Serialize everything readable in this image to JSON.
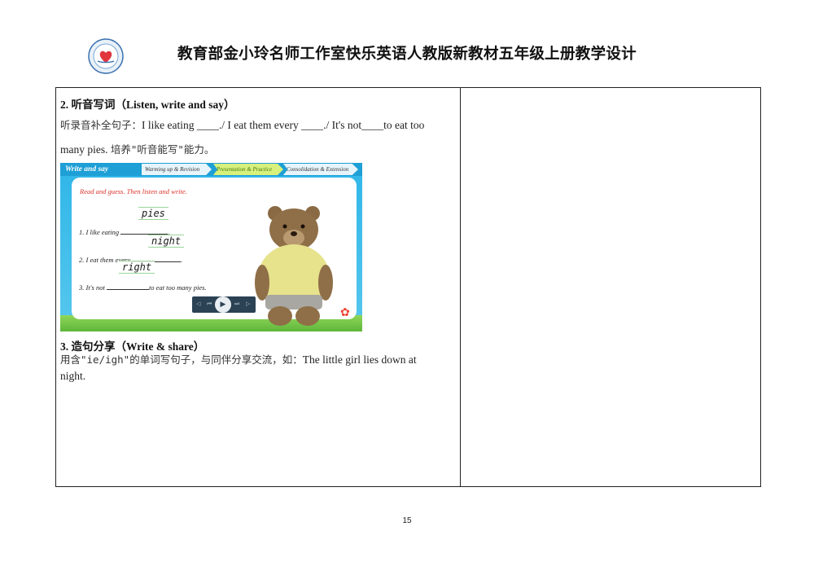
{
  "header": {
    "title": "教育部金小玲名师工作室快乐英语人教版新教材五年级上册教学设计"
  },
  "section2": {
    "heading": "2. 听音写词（Listen, write and say）",
    "line1_cn": "听录音补全句子：",
    "line1_en": "I like eating ____./ I eat them every ____./ It's not____to eat too",
    "line2_en": "many pies.",
    "line2_cn": "培养\"听音能写\"能力。"
  },
  "slide": {
    "title_tab": "Write and say",
    "tabs": [
      "Warming up & Revision",
      "Presentation & Practice",
      "Consolidation & Extension"
    ],
    "instruction": "Read and guess. Then listen and write.",
    "q1_prefix": "1.  I like eating",
    "q1_suffix": ".",
    "q1_answer": "pies",
    "q2_prefix": "2.  I eat them every",
    "q2_suffix": ".",
    "q2_answer": "night",
    "q3_prefix": "3.  It's not",
    "q3_suffix": "to eat too many pies.",
    "q3_answer": "right",
    "player_prev": "◁",
    "player_skip_back": "⏮",
    "player_play": "▶",
    "player_skip_fwd": "⏭",
    "player_next": "▷"
  },
  "section3": {
    "heading": "3. 造句分享（Write & share）",
    "line_cn": "用含\"ie/igh\"的单词写句子，与同伴分享交流，如：",
    "line_en": "The little girl lies down at",
    "line2_en": "night."
  },
  "footer": {
    "page_number": "15"
  },
  "colors": {
    "slide_blue": "#2fb6e8",
    "instruction_red": "#d8322a",
    "practice_tab_green": "#d8f07c"
  }
}
